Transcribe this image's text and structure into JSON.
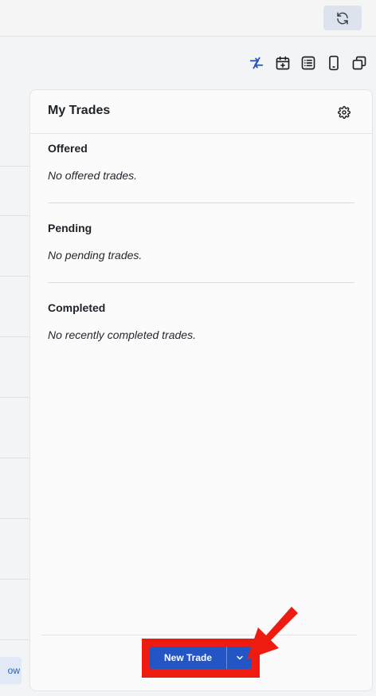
{
  "icons": {
    "refresh": "refresh-icon",
    "trades": "trade-arrows-icon",
    "calendar": "calendar-add-icon",
    "list": "list-icon",
    "mobile": "mobile-icon",
    "windows": "windows-icon",
    "settings": "gear-icon",
    "dropdown": "chevron-down-icon"
  },
  "colors": {
    "accent": "#2356c4",
    "highlight": "#ee1b10",
    "active_icon": "#2356c4"
  },
  "left_panel": {
    "button_label": "ow"
  },
  "panel": {
    "title": "My Trades",
    "sections": [
      {
        "title": "Offered",
        "empty_text": "No offered trades."
      },
      {
        "title": "Pending",
        "empty_text": "No pending trades."
      },
      {
        "title": "Completed",
        "empty_text": "No recently completed trades."
      }
    ],
    "new_trade_label": "New Trade"
  }
}
